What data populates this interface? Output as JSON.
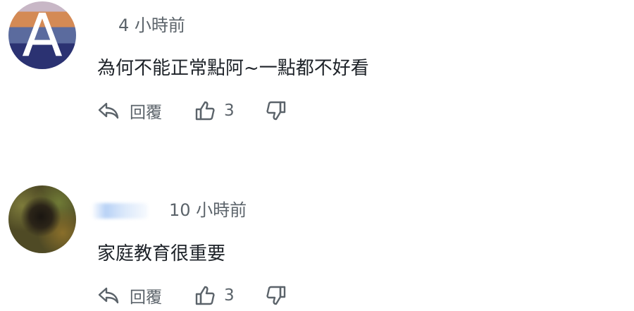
{
  "comments": [
    {
      "avatar_letter": "A",
      "username": "",
      "timestamp": "4 小時前",
      "text": "為何不能正常點阿~一點都不好看",
      "reply_label": "回覆",
      "likes": "3"
    },
    {
      "avatar_letter": "",
      "username": "",
      "timestamp": "10 小時前",
      "text": "家庭教育很重要",
      "reply_label": "回覆",
      "likes": "3"
    }
  ],
  "icons": {
    "reply": "reply-arrow-icon",
    "like": "thumbs-up-icon",
    "dislike": "thumbs-down-icon"
  },
  "colors": {
    "meta_text": "#5b636a",
    "body_text": "#1d2228",
    "icon": "#5b636a"
  }
}
